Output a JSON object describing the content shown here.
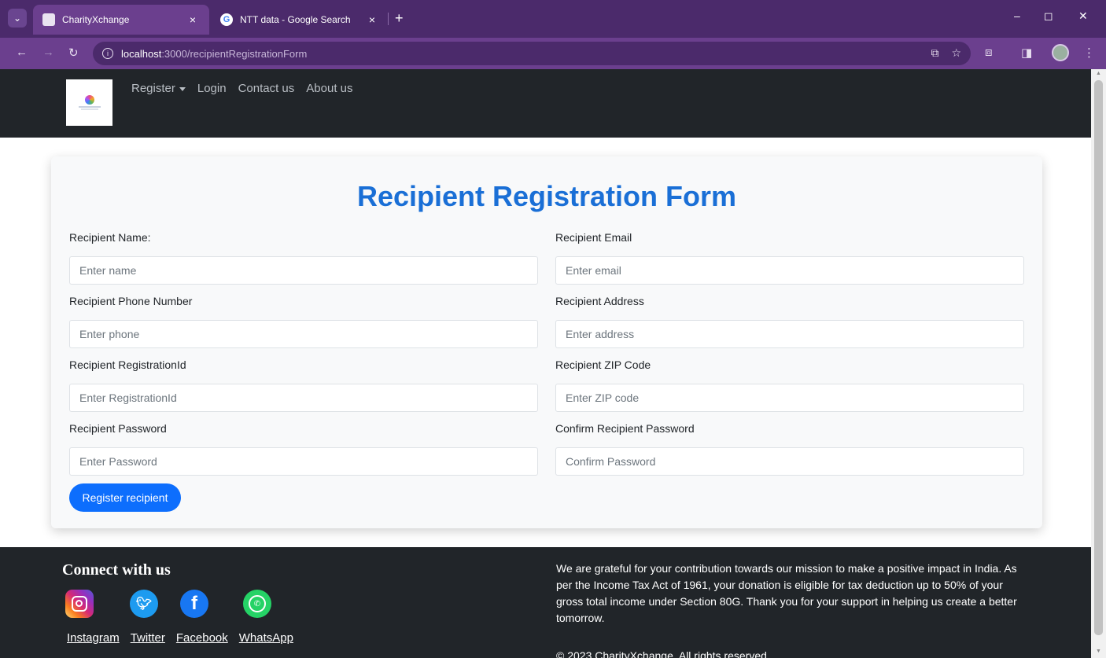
{
  "browser": {
    "tabs": [
      {
        "title": "CharityXchange",
        "active": true
      },
      {
        "title": "NTT data - Google Search",
        "active": false
      }
    ],
    "close_glyph": "×",
    "new_tab_glyph": "+",
    "url_host": "localhost",
    "url_path": ":3000/recipientRegistrationForm",
    "window_controls": {
      "minimize": "–",
      "maximize": "◻",
      "close": "✕"
    }
  },
  "navbar": {
    "links": [
      {
        "label": "Register",
        "has_dropdown": true
      },
      {
        "label": "Login"
      },
      {
        "label": "Contact us"
      },
      {
        "label": "About us"
      }
    ]
  },
  "form": {
    "title": "Recipient Registration Form",
    "fields": [
      {
        "label": "Recipient Name:",
        "placeholder": "Enter name"
      },
      {
        "label": "Recipient Email",
        "placeholder": "Enter email"
      },
      {
        "label": "Recipient Phone Number",
        "placeholder": "Enter phone"
      },
      {
        "label": "Recipient Address",
        "placeholder": "Enter address"
      },
      {
        "label": "Recipient RegistrationId",
        "placeholder": "Enter RegistrationId"
      },
      {
        "label": "Recipient ZIP Code",
        "placeholder": "Enter ZIP code"
      },
      {
        "label": "Recipient Password",
        "placeholder": "Enter Password"
      },
      {
        "label": "Confirm Recipient Password",
        "placeholder": "Confirm Password"
      }
    ],
    "submit_label": "Register recipient"
  },
  "footer": {
    "connect_title": "Connect with us",
    "social": [
      {
        "label": "Instagram",
        "icon": "instagram-icon",
        "color": "#d62976"
      },
      {
        "label": "Twitter",
        "icon": "twitter-icon",
        "color": "#1d9bf0"
      },
      {
        "label": "Facebook",
        "icon": "facebook-icon",
        "color": "#1877f2"
      },
      {
        "label": "WhatsApp",
        "icon": "whatsapp-icon",
        "color": "#25d366"
      }
    ],
    "note": "We are grateful for your contribution towards our mission to make a positive impact in India. As per the Income Tax Act of 1961, your donation is eligible for tax deduction up to 50% of your gross total income under Section 80G. Thank you for your support in helping us create a better tomorrow.",
    "copyright": "© 2023 CharityXchange. All rights reserved."
  },
  "colors": {
    "accent": "#0d6efd",
    "title_blue": "#1a6fd6",
    "dark": "#212529",
    "browser_frame": "#6b3f8e"
  }
}
